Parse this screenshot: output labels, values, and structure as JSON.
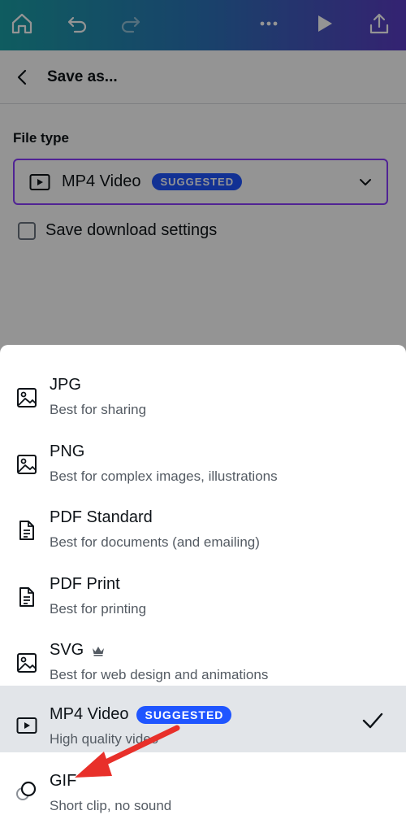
{
  "toolbar": {
    "icons": [
      "home-icon",
      "undo-icon",
      "redo-icon",
      "more-icon",
      "play-icon",
      "share-icon"
    ]
  },
  "panel": {
    "title": "Save as...",
    "file_type_label": "File type",
    "selected_file_type": "MP4 Video",
    "selected_badge": "SUGGESTED",
    "save_settings_label": "Save download settings"
  },
  "options": [
    {
      "title": "JPG",
      "subtitle": "Best for sharing",
      "icon": "image-icon"
    },
    {
      "title": "PNG",
      "subtitle": "Best for complex images, illustrations",
      "icon": "image-icon"
    },
    {
      "title": "PDF Standard",
      "subtitle": "Best for documents (and emailing)",
      "icon": "document-icon"
    },
    {
      "title": "PDF Print",
      "subtitle": "Best for printing",
      "icon": "document-icon"
    },
    {
      "title": "SVG",
      "subtitle": "Best for web design and animations",
      "icon": "image-icon",
      "premium": true
    },
    {
      "title": "MP4 Video",
      "subtitle": "High quality video",
      "icon": "video-icon",
      "badge": "SUGGESTED",
      "selected": true
    },
    {
      "title": "GIF",
      "subtitle": "Short clip, no sound",
      "icon": "gif-icon"
    }
  ],
  "colors": {
    "accent": "#8b3dff",
    "badge": "#1f55ff",
    "annotation_arrow": "#e8302a"
  }
}
